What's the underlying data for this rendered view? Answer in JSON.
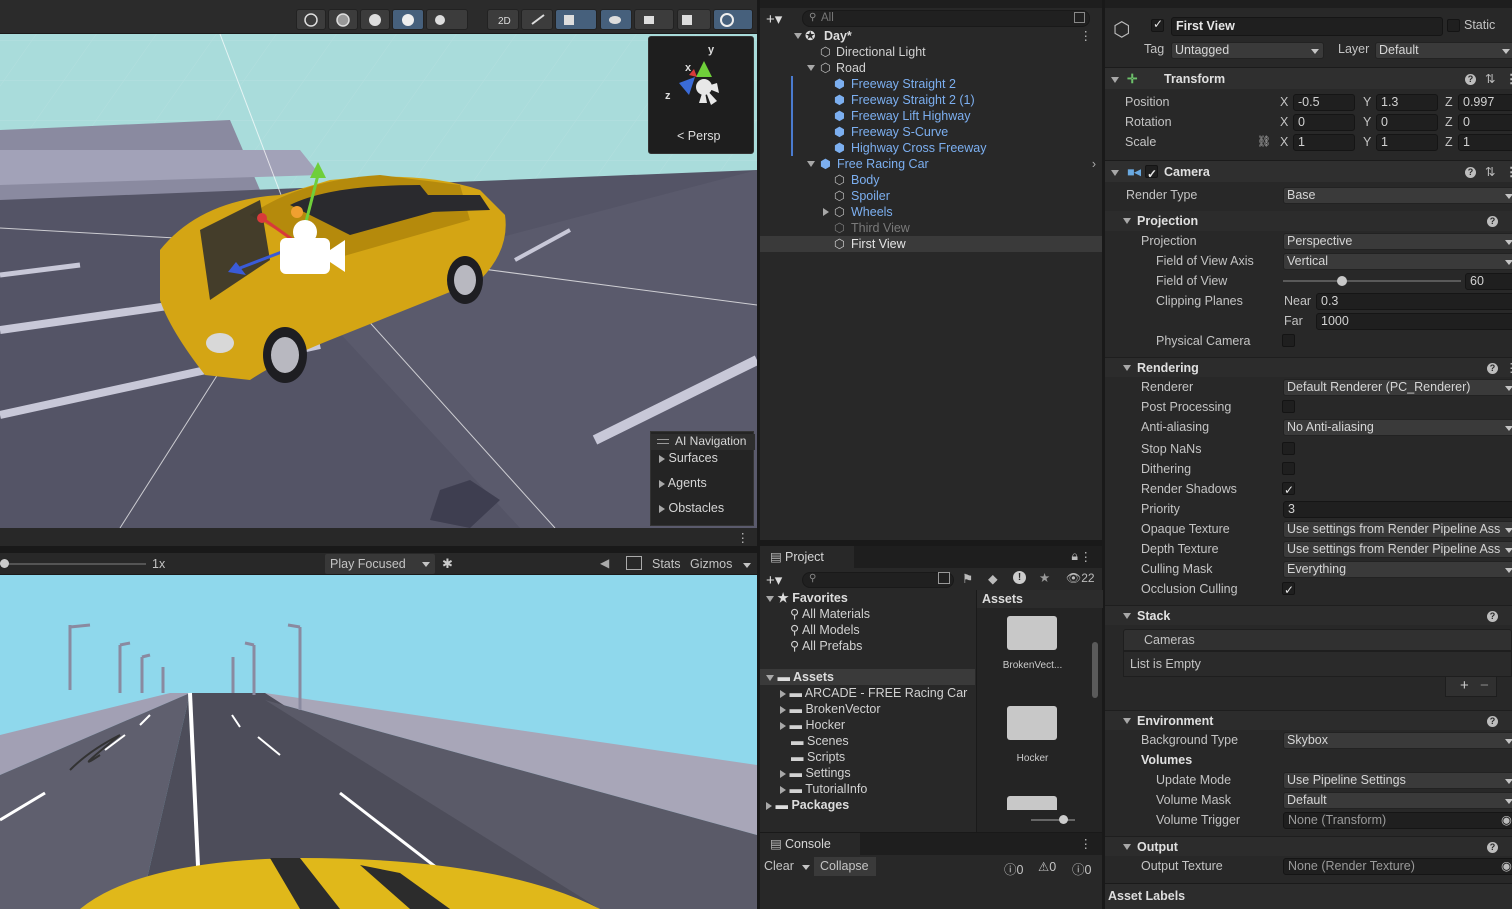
{
  "scene": {
    "persp_label": "Persp",
    "ai_nav": {
      "title": "AI Navigation",
      "items": [
        "Surfaces",
        "Agents",
        "Obstacles"
      ]
    }
  },
  "game_toolbar": {
    "scale": "1x",
    "play_mode": "Play Focused",
    "stats": "Stats",
    "gizmos": "Gizmos"
  },
  "hierarchy": {
    "search_placeholder": "All",
    "scene_name": "Day*",
    "items": [
      {
        "label": "Directional Light"
      },
      {
        "label": "Road"
      },
      {
        "label": "Freeway Straight 2"
      },
      {
        "label": "Freeway Straight 2 (1)"
      },
      {
        "label": "Freeway Lift Highway"
      },
      {
        "label": "Freeway S-Curve"
      },
      {
        "label": "Highway Cross Freeway"
      },
      {
        "label": "Free Racing Car"
      },
      {
        "label": "Body"
      },
      {
        "label": "Spoiler"
      },
      {
        "label": "Wheels"
      },
      {
        "label": "Third View"
      },
      {
        "label": "First View"
      }
    ]
  },
  "project": {
    "tab": "Project",
    "hidden_count": "22",
    "favorites": {
      "title": "Favorites",
      "items": [
        "All Materials",
        "All Models",
        "All Prefabs"
      ]
    },
    "assets_root": "Assets",
    "asset_folders": [
      "ARCADE - FREE Racing Car",
      "BrokenVector",
      "Hocker",
      "Scenes",
      "Scripts",
      "Settings",
      "TutorialInfo"
    ],
    "packages": "Packages",
    "grid_header": "Assets",
    "grid_items": [
      "BrokenVect...",
      "Hocker"
    ]
  },
  "console": {
    "tab": "Console",
    "clear": "Clear",
    "collapse": "Collapse",
    "counts": [
      "0",
      "0",
      "0"
    ]
  },
  "inspector": {
    "object_name": "First View",
    "static_label": "Static",
    "tag_label": "Tag",
    "tag_value": "Untagged",
    "layer_label": "Layer",
    "layer_value": "Default",
    "transform": {
      "title": "Transform",
      "position_label": "Position",
      "position": [
        "-0.5",
        "1.3",
        "0.997"
      ],
      "rotation_label": "Rotation",
      "rotation": [
        "0",
        "0",
        "0"
      ],
      "scale_label": "Scale",
      "scale": [
        "1",
        "1",
        "1"
      ],
      "axes": [
        "X",
        "Y",
        "Z"
      ]
    },
    "camera": {
      "title": "Camera",
      "render_type_label": "Render Type",
      "render_type": "Base",
      "projection_header": "Projection",
      "projection_label": "Projection",
      "projection": "Perspective",
      "fov_axis_label": "Field of View Axis",
      "fov_axis": "Vertical",
      "fov_label": "Field of View",
      "fov": "60",
      "fov_fraction": 0.33,
      "clipping_label": "Clipping Planes",
      "near_label": "Near",
      "near": "0.3",
      "far_label": "Far",
      "far": "1000",
      "physical_label": "Physical Camera",
      "rendering_header": "Rendering",
      "renderer_label": "Renderer",
      "renderer": "Default Renderer (PC_Renderer)",
      "post_label": "Post Processing",
      "aa_label": "Anti-aliasing",
      "aa": "No Anti-aliasing",
      "stopnans_label": "Stop NaNs",
      "dither_label": "Dithering",
      "shadows_label": "Render Shadows",
      "priority_label": "Priority",
      "priority": "3",
      "opaque_label": "Opaque Texture",
      "opaque": "Use settings from Render Pipeline Ass",
      "depth_label": "Depth Texture",
      "depth": "Use settings from Render Pipeline Ass",
      "culling_label": "Culling Mask",
      "culling": "Everything",
      "occlusion_label": "Occlusion Culling",
      "stack_header": "Stack",
      "cameras_label": "Cameras",
      "list_empty": "List is Empty",
      "env_header": "Environment",
      "bg_label": "Background Type",
      "bg": "Skybox",
      "volumes_label": "Volumes",
      "update_label": "Update Mode",
      "update": "Use Pipeline Settings",
      "vmask_label": "Volume Mask",
      "vmask": "Default",
      "vtrigger_label": "Volume Trigger",
      "vtrigger": "None (Transform)",
      "output_header": "Output",
      "output_tex_label": "Output Texture",
      "output_tex": "None (Render Texture)"
    },
    "asset_labels": "Asset Labels"
  },
  "colors": {
    "accent_blue": "#7caff0",
    "panel": "#282828",
    "selection": "#3a3a3a"
  }
}
